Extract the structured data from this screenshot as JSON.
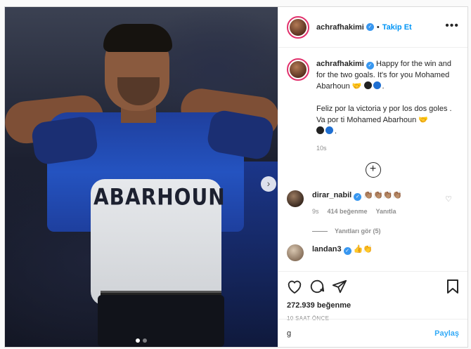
{
  "post": {
    "image": {
      "shirt_text": "ABARHOUN",
      "next_icon": "chevron-right-icon",
      "carousel": {
        "count": 2,
        "active": 1
      }
    },
    "header": {
      "username": "achrafhakimi",
      "separator": "•",
      "follow_label": "Takip Et",
      "more_icon": "ellipsis-icon"
    },
    "caption": {
      "username": "achrafhakimi",
      "line1": "Happy for the win and for the two goals. It's for you Mohamed Abarhoun",
      "line2": "Feliz por la victoria y por los dos goles . Va por ti Mohamed Abarhoun",
      "time": "10s",
      "load_more_icon": "plus-circle-icon"
    },
    "comments": [
      {
        "username": "dirar_nabil",
        "text": "👏🏽👏🏽👏🏽👏🏽",
        "time": "9s",
        "likes": "414 beğenme",
        "reply": "Yanıtla",
        "view_replies": "Yanıtları gör (5)"
      },
      {
        "username": "landan3",
        "text": "👍👏"
      }
    ],
    "actions": {
      "like_icon": "heart-icon",
      "comment_icon": "comment-icon",
      "share_icon": "share-icon",
      "save_icon": "bookmark-icon",
      "likes_count": "272.939 beğenme",
      "time_ago": "10 SAAT ÖNCE"
    },
    "add_comment": {
      "value": "g",
      "post_label": "Paylaş"
    },
    "colors": {
      "accent": "#0095f6",
      "verified": "#3897f0",
      "story_ring": "#e1306c",
      "text": "#262626",
      "muted": "#8e8e8e"
    }
  }
}
